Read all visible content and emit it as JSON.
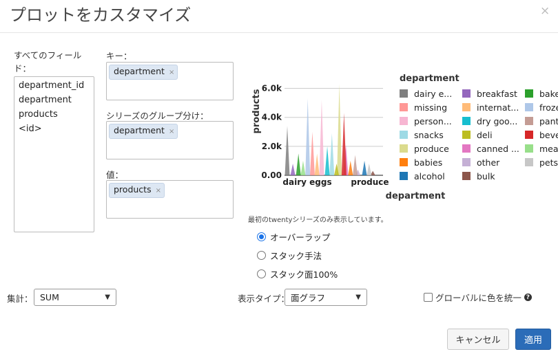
{
  "dialog": {
    "title": "プロットをカスタマイズ",
    "close": "×"
  },
  "fields": {
    "label": "すべてのフィール\nド：",
    "items": [
      "department_id",
      "department",
      "products",
      "<id>"
    ]
  },
  "key": {
    "label": "キー：",
    "tag": "department"
  },
  "series_group": {
    "label": "シリーズのグループ分け：",
    "tag": "department"
  },
  "value": {
    "label": "値：",
    "tag": "products"
  },
  "tag_remove": "×",
  "chart_data": {
    "type": "area",
    "ylabel": "products",
    "xlabel": "department",
    "x_ticks": [
      "dairy eggs",
      "produce"
    ],
    "y_ticks": [
      "0.00",
      "2.0k",
      "4.0k",
      "6.0k"
    ],
    "ylim": [
      0,
      6500
    ],
    "legend_title": "department",
    "legend_placement": "right",
    "series": [
      {
        "name": "dairy e...",
        "color": "#7f7f7f",
        "x": 0.0,
        "peak": 3400
      },
      {
        "name": "missing",
        "color": "#ff9896",
        "x": 0.27,
        "peak": 3000
      },
      {
        "name": "person...",
        "color": "#f7b6d2",
        "x": 0.37,
        "peak": 5200
      },
      {
        "name": "snacks",
        "color": "#9edae5",
        "x": 0.48,
        "peak": 2900
      },
      {
        "name": "produce",
        "color": "#dbdb8d",
        "x": 0.56,
        "peak": 6300
      },
      {
        "name": "babies",
        "color": "#ff7f0e",
        "x": 0.68,
        "peak": 1000
      },
      {
        "name": "alcohol",
        "color": "#1f77b4",
        "x": 0.83,
        "peak": 1000
      },
      {
        "name": "breakfast",
        "color": "#9467bd",
        "x": 0.06,
        "peak": 800
      },
      {
        "name": "internat...",
        "color": "#ffbb78",
        "x": 0.32,
        "peak": 1500
      },
      {
        "name": "dry goo...",
        "color": "#17becf",
        "x": 0.43,
        "peak": 2000
      },
      {
        "name": "deli",
        "color": "#bcbd22",
        "x": 0.53,
        "peak": 800
      },
      {
        "name": "canned ...",
        "color": "#e377c2",
        "x": 0.63,
        "peak": 2100
      },
      {
        "name": "other",
        "color": "#c5b0d5",
        "x": 0.76,
        "peak": 400
      },
      {
        "name": "bulk",
        "color": "#8c564b",
        "x": 0.92,
        "peak": 300
      },
      {
        "name": "bake...",
        "color": "#2ca02c",
        "x": 0.12,
        "peak": 1500
      },
      {
        "name": "froze...",
        "color": "#aec7e8",
        "x": 0.22,
        "peak": 5300
      },
      {
        "name": "pant...",
        "color": "#c49c94",
        "x": 0.73,
        "peak": 1400
      },
      {
        "name": "beve...",
        "color": "#d62728",
        "x": 0.61,
        "peak": 4300
      },
      {
        "name": "meat...",
        "color": "#98df8a",
        "x": 0.17,
        "peak": 1000
      },
      {
        "name": "pets",
        "color": "#c7c7c7",
        "x": 0.88,
        "peak": 800
      }
    ]
  },
  "note": "最初のtwentyシリーズのみ表示しています。",
  "radios": [
    {
      "label": "オーバーラップ",
      "checked": true
    },
    {
      "label": "スタック手法",
      "checked": false
    },
    {
      "label": "スタック面100%",
      "checked": false
    }
  ],
  "aggregate": {
    "label": "集計：",
    "value": "SUM"
  },
  "display_type": {
    "label": "表示タイプ：",
    "value": "面グラフ"
  },
  "global_color": {
    "label": "グローバルに色を統一",
    "checked": false,
    "help": "?"
  },
  "buttons": {
    "cancel": "キャンセル",
    "apply": "適用"
  }
}
